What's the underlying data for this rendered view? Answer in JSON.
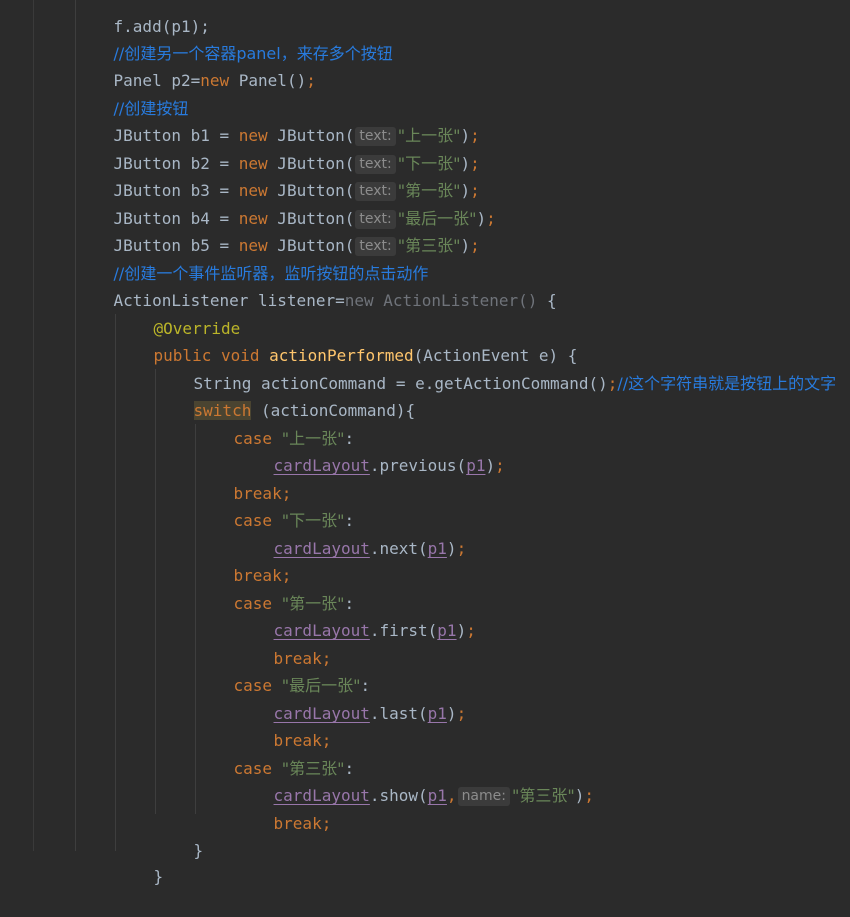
{
  "code": {
    "l0": "f.add(p1);",
    "l1_comment": "//创建另一个容器panel，来存多个按钮",
    "l2_a": "Panel p2=",
    "l2_kw": "new",
    "l2_b": " Panel()",
    "l2_semi": ";",
    "l3_comment": "//创建按钮",
    "buttons": [
      {
        "decl": "JButton b1 = ",
        "text": "\"上一张\""
      },
      {
        "decl": "JButton b2 = ",
        "text": "\"下一张\""
      },
      {
        "decl": "JButton b3 = ",
        "text": "\"第一张\""
      },
      {
        "decl": "JButton b4 = ",
        "text": "\"最后一张\""
      },
      {
        "decl": "JButton b5 = ",
        "text": "\"第三张\""
      }
    ],
    "kw_new": "new",
    "jbutton_call": " JButton(",
    "hint_text": "text:",
    "close_paren": ")",
    "semi": ";",
    "l9_comment": "//创建一个事件监听器，监听按钮的点击动作",
    "l10_a": "ActionListener listener=",
    "l10_new": "new",
    "l10_b": " ActionListener()",
    "l10_c": " {",
    "l11_ann": "@Override",
    "l12_kw": "public void",
    "l12_fn": "actionPerformed",
    "l12_rest": "(ActionEvent e) {",
    "l13_code": "String actionCommand = e.getActionCommand()",
    "l13_comment": "//这个字符串就是按钮上的文字",
    "l14_kw": "switch",
    "l14_rest": " (actionCommand){",
    "kw_case": "case",
    "kw_break": "break",
    "colon": ":",
    "field": "cardLayout",
    "arg": "p1",
    "cases": [
      "\"上一张\"",
      "\"下一张\"",
      "\"第一张\"",
      "\"最后一张\"",
      "\"第三张\""
    ],
    "methods": [
      ".previous(",
      ".next(",
      ".first(",
      ".last(",
      ".show("
    ],
    "hint_name": "name:",
    "show_name": "\"第三张\"",
    "comma": ",",
    "close_brace": "}"
  }
}
